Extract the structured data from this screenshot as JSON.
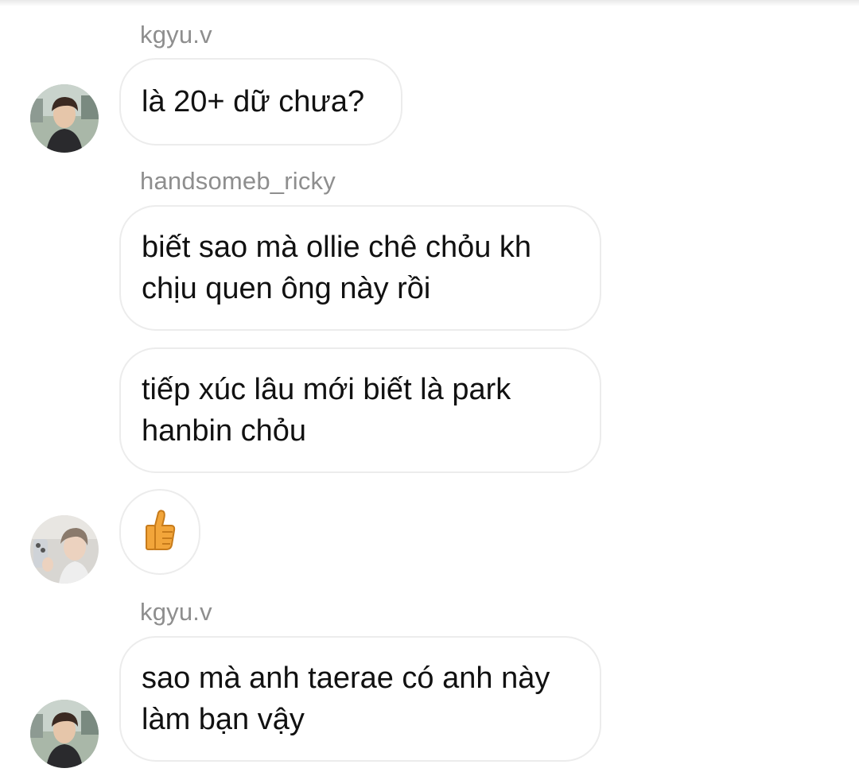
{
  "messages": [
    {
      "sender": "kgyu.v",
      "text": "là 20+ dữ chưa?"
    },
    {
      "sender": "handsomeb_ricky",
      "text": "biết sao mà ollie chê chỏu kh chịu quen ông này rồi"
    },
    {
      "text": "tiếp xúc lâu mới biết là park hanbin chỏu"
    },
    {
      "reaction_icon": "thumbs-up-icon"
    },
    {
      "sender": "kgyu.v",
      "text": "sao mà anh taerae có anh này làm bạn vậy"
    }
  ],
  "colors": {
    "bubble_border": "#ececec",
    "sender_name": "#8e8e8e",
    "text": "#111111",
    "thumb": "#f2a53a"
  }
}
